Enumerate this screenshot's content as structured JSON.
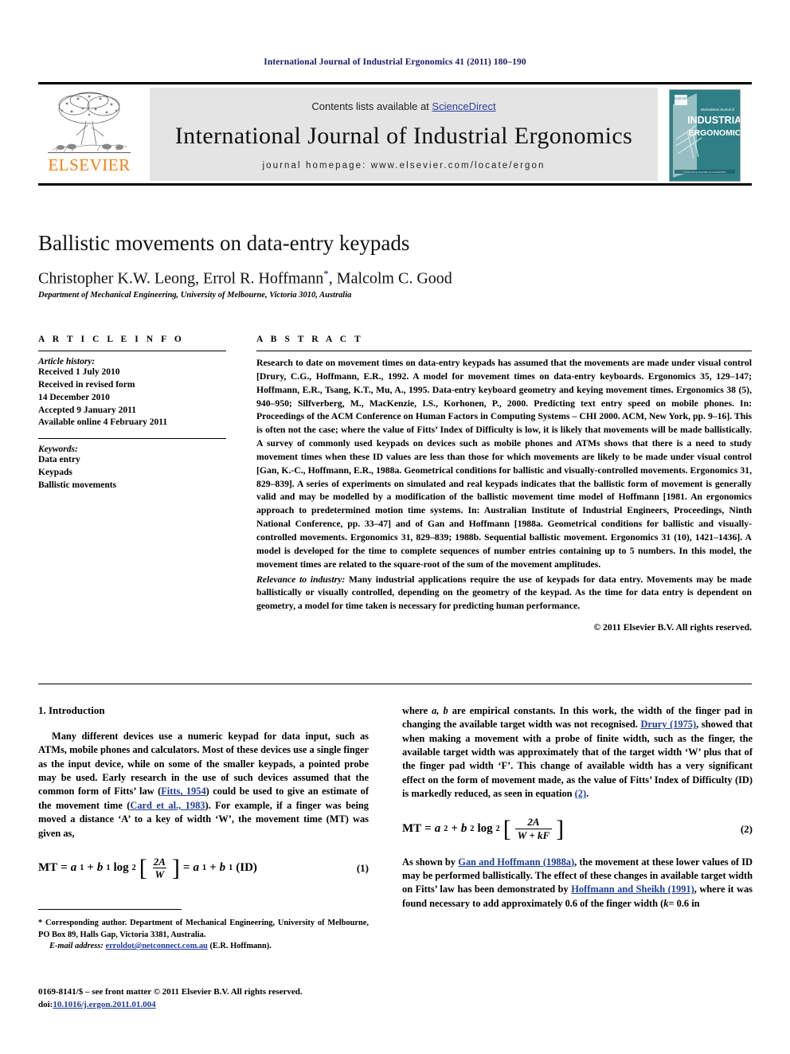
{
  "running_head": "International Journal of Industrial Ergonomics 41 (2011) 180–190",
  "masthead": {
    "publisher": "ELSEVIER",
    "contents_prefix": "Contents lists available at ",
    "sciencedirect": "ScienceDirect",
    "journal_title": "International Journal of Industrial Ergonomics",
    "homepage": "journal homepage: www.elsevier.com/locate/ergon",
    "cover": {
      "kicker": "International Journal of",
      "line1": "INDUSTRIAL",
      "line2": "ERGONOMICS",
      "footer": "Incorporating Scientific Journal ERGON",
      "color": "#2f7f86"
    }
  },
  "article": {
    "title": "Ballistic movements on data-entry keypads",
    "authors": "Christopher K.W. Leong, Errol R. Hoffmann",
    "authors_tail": ", Malcolm C. Good",
    "corresponding_marker": "*",
    "affiliation": "Department of Mechanical Engineering, University of Melbourne, Victoria 3010, Australia"
  },
  "info": {
    "heading": "A R T I C L E   I N F O",
    "history_label": "Article history:",
    "history": [
      "Received 1 July 2010",
      "Received in revised form",
      "14 December 2010",
      "Accepted 9 January 2011",
      "Available online 4 February 2011"
    ],
    "keywords_label": "Keywords:",
    "keywords": [
      "Data entry",
      "Keypads",
      "Ballistic movements"
    ]
  },
  "abstract": {
    "heading": "A B S T R A C T",
    "body": "Research to date on movement times on data-entry keypads has assumed that the movements are made under visual control [Drury, C.G., Hoffmann, E.R., 1992. A model for movement times on data-entry keyboards. Ergonomics 35, 129–147; Hoffmann, E.R., Tsang, K.T., Mu, A., 1995. Data-entry keyboard geometry and keying movement times. Ergonomics 38 (5), 940–950; Silfverberg, M., MacKenzie, I.S., Korhonen, P., 2000. Predicting text entry speed on mobile phones. In: Proceedings of the ACM Conference on Human Factors in Computing Systems – CHI 2000. ACM, New York, pp. 9–16]. This is often not the case; where the value of Fitts’ Index of Difficulty is low, it is likely that movements will be made ballistically. A survey of commonly used keypads on devices such as mobile phones and ATMs shows that there is a need to study movement times when these ID values are less than those for which movements are likely to be made under visual control [Gan, K.-C., Hoffmann, E.R., 1988a. Geometrical conditions for ballistic and visually-controlled movements. Ergonomics 31, 829–839]. A series of experiments on simulated and real keypads indicates that the ballistic form of movement is generally valid and may be modelled by a modification of the ballistic movement time model of Hoffmann [1981. An ergonomics approach to predetermined motion time systems. In: Australian Institute of Industrial Engineers, Proceedings, Ninth National Conference, pp. 33–47] and of Gan and Hoffmann [1988a. Geometrical conditions for ballistic and visually-controlled movements. Ergonomics 31, 829–839; 1988b. Sequential ballistic movement. Ergonomics 31 (10), 1421–1436]. A model is developed for the time to complete sequences of number entries containing up to 5 numbers. In this model, the movement times are related to the square-root of the sum of the movement amplitudes.",
    "relevance_label": "Relevance to industry:",
    "relevance_body": " Many industrial applications require the use of keypads for data entry. Movements may be made ballistically or visually controlled, depending on the geometry of the keypad. As the time for data entry is dependent on geometry, a model for time taken is necessary for predicting human performance.",
    "copyright": "© 2011 Elsevier B.V. All rights reserved."
  },
  "body": {
    "section_number": "1.",
    "section_title": "Introduction",
    "left_para_1a": "Many different devices use a numeric keypad for data input, such as ATMs, mobile phones and calculators. Most of these devices use a single finger as the input device, while on some of the smaller keypads, a pointed probe may be used. Early research in the use of such devices assumed that the common form of Fitts’ law (",
    "cite_fitts": "Fitts, 1954",
    "left_para_1b": ") could be used to give an estimate of the movement time (",
    "cite_card": "Card et al., 1983",
    "left_para_1c": "). For example, if a finger was being moved a distance ‘A’ to a key of width ‘W’, the movement time (MT) was given as,",
    "equation_1": {
      "lhs": "MT",
      "eq": "=",
      "a_term": "a",
      "a_sub": "1",
      "plus": "+",
      "b_term": "b",
      "b_sub": "1",
      "log": "log",
      "log_base": "2",
      "numerator": "2A",
      "denominator": "W",
      "rhs_tail": "(ID)",
      "number": "(1)"
    },
    "right_para_1a": "where ",
    "right_para_1a_it": "a, b",
    "right_para_1b": " are empirical constants. In this work, the width of the finger pad in changing the available target width was not recognised. ",
    "cite_drury": "Drury (1975)",
    "right_para_1c": ", showed that when making a movement with a probe of finite width, such as the finger, the available target width was approximately that of the target width ‘W’ plus that of the finger pad width ‘F’. This change of available width has a very significant effect on the form of movement made, as the value of Fitts’ Index of Difficulty (ID) is markedly reduced, as seen in equation ",
    "cite_eq2": "(2)",
    "right_para_1d": ".",
    "equation_2": {
      "lhs": "MT",
      "eq": "=",
      "a_term": "a",
      "a_sub": "2",
      "plus": "+",
      "b_term": "b",
      "b_sub": "2",
      "log": "log",
      "log_base": "2",
      "numerator": "2A",
      "denominator": "W + kF",
      "number": "(2)"
    },
    "right_para_2a": "As shown by ",
    "cite_gan": "Gan and Hoffmann (1988a)",
    "right_para_2b": ", the movement at these lower values of ID may be performed ballistically. The effect of these changes in available target width on Fitts’ law has been demonstrated by ",
    "cite_hoffmann": "Hoffmann and Sheikh (1991)",
    "right_para_2c": ", where it was found necessary to add approximately 0.6 of the finger width (",
    "right_para_2c_it": "k",
    "right_para_2d": "= 0.6 in"
  },
  "footnotes": {
    "corresponding": "* Corresponding author. Department of Mechanical Engineering, University of Melbourne, PO Box 89, Halls Gap, Victoria 3381, Australia.",
    "email_label": "E-mail address:",
    "email": "erroldot@netconnect.com.au",
    "email_attrib": "(E.R. Hoffmann).",
    "issn_line": "0169-8141/$ – see front matter © 2011 Elsevier B.V. All rights reserved.",
    "doi_label": "doi:",
    "doi": "10.1016/j.ergon.2011.01.004"
  }
}
